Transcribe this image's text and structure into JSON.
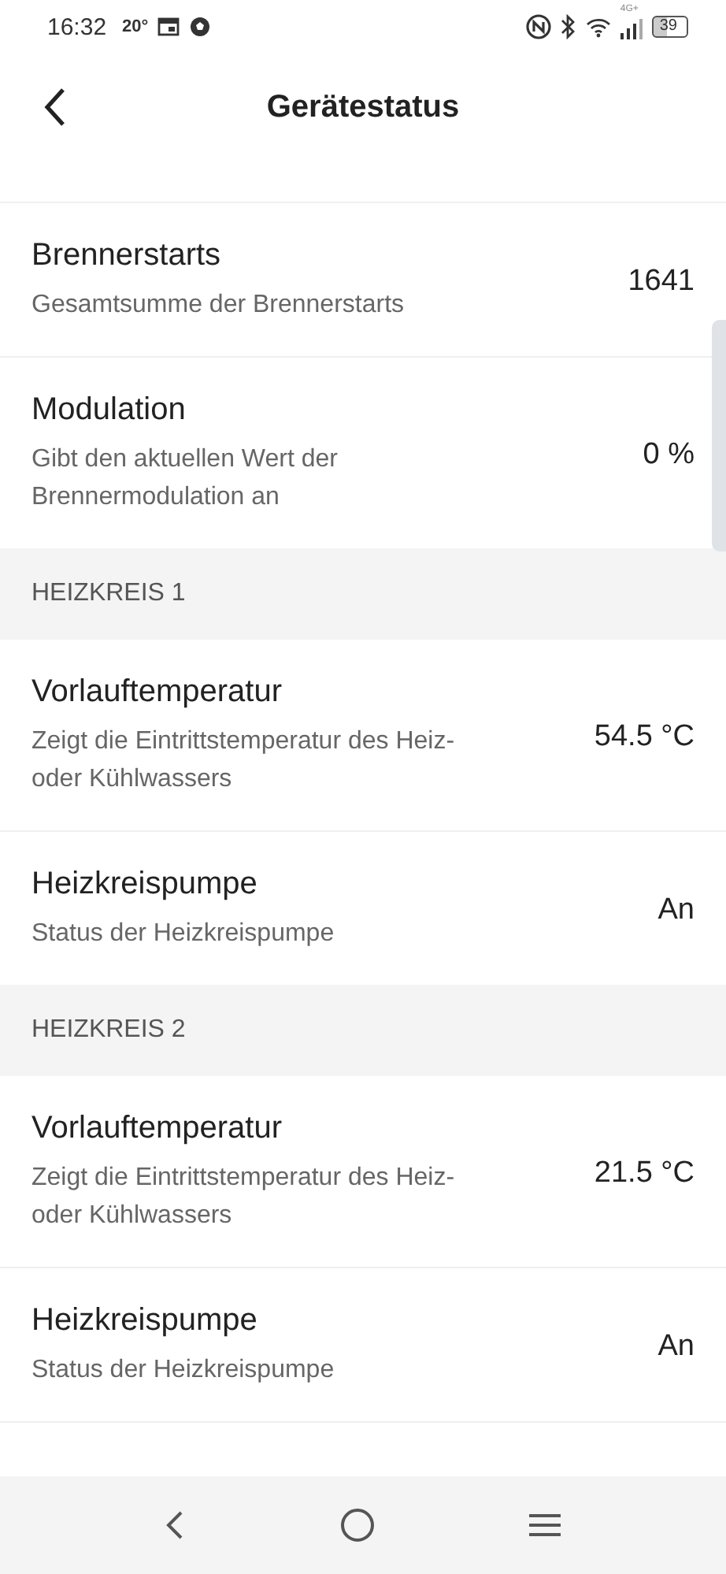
{
  "status_bar": {
    "time": "16:32",
    "temperature": "20°",
    "network": "4G+",
    "battery": "39"
  },
  "header": {
    "title": "Gerätestatus"
  },
  "sections": [
    {
      "items": [
        {
          "title": "Brennerstarts",
          "subtitle": "Gesamtsumme der Brennerstarts",
          "value": "1641"
        },
        {
          "title": "Modulation",
          "subtitle": "Gibt den aktuellen Wert der Brennermodulation an",
          "value": "0 %"
        }
      ]
    },
    {
      "title": "HEIZKREIS 1",
      "items": [
        {
          "title": "Vorlauftemperatur",
          "subtitle": "Zeigt die Eintrittstemperatur des Heiz- oder Kühlwassers",
          "value": "54.5 °C"
        },
        {
          "title": "Heizkreispumpe",
          "subtitle": "Status der Heizkreispumpe",
          "value": "An"
        }
      ]
    },
    {
      "title": "HEIZKREIS 2",
      "items": [
        {
          "title": "Vorlauftemperatur",
          "subtitle": "Zeigt die Eintrittstemperatur des Heiz- oder Kühlwassers",
          "value": "21.5 °C"
        },
        {
          "title": "Heizkreispumpe",
          "subtitle": "Status der Heizkreispumpe",
          "value": "An"
        }
      ]
    }
  ]
}
